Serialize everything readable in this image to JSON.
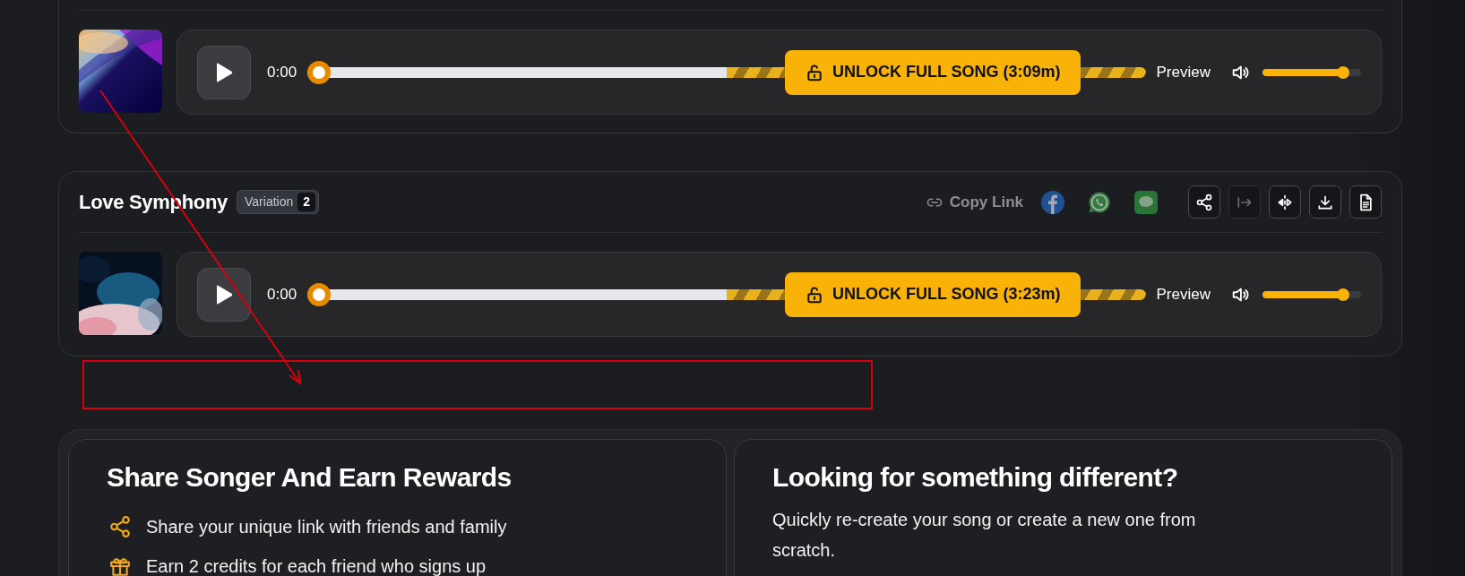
{
  "songs": [
    {
      "player": {
        "time": "0:00",
        "level": 0,
        "unlock_label": "UNLOCK FULL SONG (3:09m)",
        "preview_label": "Preview",
        "volume": {
          "level": 0.82
        }
      }
    },
    {
      "title": "Love Symphony",
      "badge": {
        "label": "Variation",
        "count": "2"
      },
      "copy_link": "Copy Link",
      "social": [
        {
          "kind": "facebook"
        },
        {
          "kind": "whatsapp"
        },
        {
          "kind": "message"
        }
      ],
      "actions": [
        {
          "kind": "share",
          "disabled": false
        },
        {
          "kind": "next",
          "disabled": true
        },
        {
          "kind": "mirror",
          "disabled": false
        },
        {
          "kind": "download",
          "disabled": false
        },
        {
          "kind": "document",
          "disabled": false
        }
      ],
      "player": {
        "time": "0:00",
        "level": 0,
        "unlock_label": "UNLOCK FULL SONG (3:23m)",
        "preview_label": "Preview",
        "volume": {
          "level": 0.82
        }
      }
    }
  ],
  "rewards": {
    "title": "Share Songer And Earn Rewards",
    "items": [
      {
        "kind": "share",
        "text": "Share your unique link with friends and family"
      },
      {
        "kind": "gift",
        "text": "Earn 2 credits for each friend who signs up"
      }
    ]
  },
  "explore": {
    "title": "Looking for something different?",
    "text": "Quickly re-create your song or create a new one from scratch."
  },
  "annotations": {
    "arrow": true,
    "frame": true
  }
}
